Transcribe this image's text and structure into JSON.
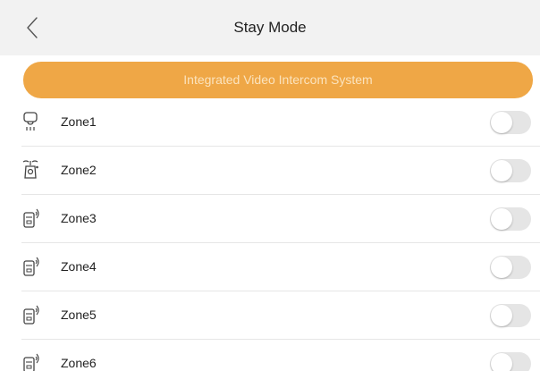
{
  "header": {
    "title": "Stay Mode",
    "back_icon": "chevron-left-icon",
    "background": "#f2f2f2"
  },
  "banner": {
    "text": "Integrated Video Intercom System",
    "color": "#efa746"
  },
  "zones": [
    {
      "label": "Zone1",
      "icon": "smoke-detector-icon",
      "enabled": false
    },
    {
      "label": "Zone2",
      "icon": "gas-detector-icon",
      "enabled": false
    },
    {
      "label": "Zone3",
      "icon": "wireless-door-sensor-icon",
      "enabled": false
    },
    {
      "label": "Zone4",
      "icon": "wireless-door-sensor-icon",
      "enabled": false
    },
    {
      "label": "Zone5",
      "icon": "wireless-door-sensor-icon",
      "enabled": false
    },
    {
      "label": "Zone6",
      "icon": "wireless-door-sensor-icon",
      "enabled": false
    }
  ],
  "toggle_off_color": "#e5e5e5"
}
